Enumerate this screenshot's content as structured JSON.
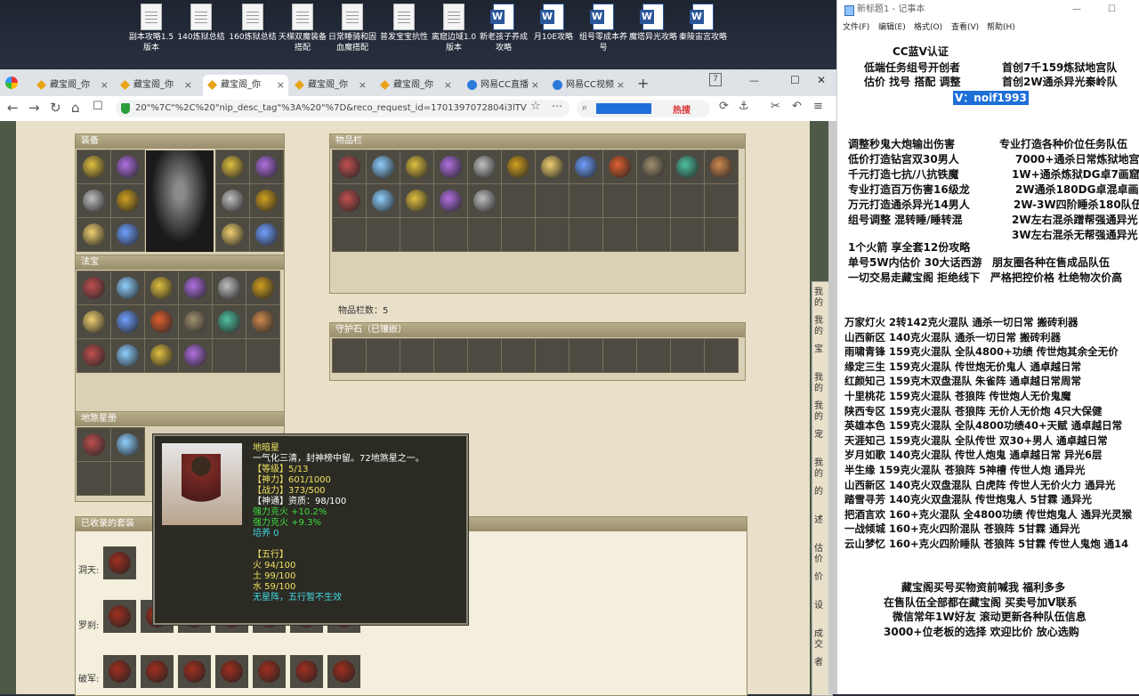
{
  "desktop": {
    "icons": [
      {
        "label": "副本攻略1.5版本",
        "type": "doc"
      },
      {
        "label": "140炼狱总结",
        "type": "doc"
      },
      {
        "label": "160炼狱总结",
        "type": "doc"
      },
      {
        "label": "天梯双魔装备搭配",
        "type": "doc"
      },
      {
        "label": "日常睡骑和固血魔搭配",
        "type": "doc"
      },
      {
        "label": "普发宝宝抗性",
        "type": "doc"
      },
      {
        "label": "离窟边域1.0版本",
        "type": "doc"
      },
      {
        "label": "新老孩子养成攻略",
        "type": "word"
      },
      {
        "label": "月10E攻略",
        "type": "word"
      },
      {
        "label": "组号零成本养号",
        "type": "word"
      },
      {
        "label": "魔塔异光攻略",
        "type": "word"
      },
      {
        "label": "秦陵宙宫攻略",
        "type": "word"
      }
    ]
  },
  "browser": {
    "tabs": [
      "藏宝阁_你",
      "藏宝阁_你",
      "藏宝阁_你",
      "藏宝阁_你",
      "藏宝阁_你",
      "网易CC直播",
      "网易CC视频"
    ],
    "active_tab": 2,
    "url": "20\"%7C\"%2C%20\"nip_desc_tag\"%3A%20\"%7D&reco_request_id=1701397072804i3lTV",
    "hot_label": "热搜",
    "new_tab": "+",
    "win_controls": {
      "min": "—",
      "max": "☐",
      "close": "✕"
    }
  },
  "game": {
    "equip_title": "装备",
    "fabao_title": "法宝",
    "disha_title": "地煞星册",
    "items_title": "物品栏",
    "items_count_label": "物品栏数：5",
    "guardian_title": "守护石（已镶嵌）",
    "collected_title": "已收录的套装",
    "sets": [
      "洞天:",
      "罗刹:",
      "破军:"
    ]
  },
  "tooltip": {
    "name": "地暗星",
    "desc": "一气化三清，封神榜中留。72地煞星之一。",
    "level": "【等级】5/13",
    "shenli": "【神力】601/1000",
    "zhanli": "【战力】373/500",
    "shentong": "【神通】资质：98/100",
    "resist1": "强力克火 +10.2%",
    "resist2": "强力克火 +9.3%",
    "peiyang": "培养 0",
    "wuxing_title": "【五行】",
    "fire": "火 94/100",
    "earth": "土 99/100",
    "water": "水 59/100",
    "note": "无星阵，五行暂不生效"
  },
  "side_strip": [
    "我的",
    "我的",
    "宝",
    "我的",
    "我的",
    "宠",
    "我的",
    "的",
    "述",
    "估价",
    "价",
    "设",
    "成交",
    "者"
  ],
  "notepad": {
    "title": "新标题1 - 记事本",
    "menu": [
      "文件(F)",
      "编辑(E)",
      "格式(O)",
      "查看(V)",
      "帮助(H)"
    ],
    "header": [
      "CC蓝V认证",
      "低端任务组号开创者",
      "首创7千159炼狱地宫队",
      "估价 找号 搭配 调整",
      "首创2W通杀异光秦岭队",
      "V：noif1993"
    ],
    "block1_left": [
      "调整秒鬼大炮输出伤害",
      "低价打造钻宫双30男人",
      "千元打造七抗/八抗铁魔",
      "专业打造百万伤害16级龙",
      "万元打造通杀异光14男人",
      "组号调整 混转睡/睡转混"
    ],
    "block1_right": [
      "专业打造各种价位任务队伍",
      "7000+通杀日常炼狱地宫",
      "1W+通杀炼狱DG卓7画窟",
      "2W通杀180DG卓混卓画",
      "2W-3W四阶睡杀180队伍",
      "2W左右混杀蹭帮强通异光",
      "3W左右混杀无帮强通异光"
    ],
    "block2": [
      "1个火箭 享全套12份攻略",
      "单号5W内估价 30大话西游",
      "朋友圈各种在售成品队伍",
      "一切交易走藏宝阁 拒绝线下",
      "严格把控价格 杜绝物次价高"
    ],
    "block3": [
      "万家灯火 2转142克火混队 通杀一切日常 搬砖利器",
      "山西新区 140克火混队 通杀一切日常 搬砖利器",
      "雨啸青锋 159克火混队 全队4800+功绩 传世炮其余全无价",
      "缘定三生 159克火混队 传世炮无价鬼人 通卓越日常",
      "红颜知己 159克木双盘混队 朱雀阵 通卓越日常周常",
      "十里桃花 159克火混队 苍狼阵 传世炮人无价鬼魔",
      "陕西专区 159克火混队 苍狼阵 无价人无价炮 4只大保健",
      "英雄本色 159克火混队 全队4800功绩40+天赋 通卓越日常",
      "天涯知己 159克火混队 全队传世 双30+男人 通卓越日常",
      "岁月如歌 140克火混队 传世人炮鬼 通卓越日常 异光6层",
      "半生缘 159克火混队 苍狼阵 5神槽 传世人炮 通异光",
      "山西新区 140克火双盘混队 白虎阵 传世人无价火力 通异光",
      "踏雪寻芳 140克火双盘混队 传世炮鬼人 5甘霖 通异光",
      "把酒言欢 160+克火混队 全4800功绩 传世炮鬼人 通异光灵猴",
      "一战倾城 160+克火四阶混队 苍狼阵 5甘霖 通异光",
      "云山梦忆 160+克火四阶睡队 苍狼阵 5甘霖 传世人鬼炮 通14"
    ],
    "block4": [
      "藏宝阁买号买物资前喊我 福利多多",
      "在售队伍全部都在藏宝阁 买卖号加V联系",
      "微信常年1W好友 滚动更新各种队伍信息",
      "3000+位老板的选择 欢迎比价 放心选购"
    ]
  }
}
